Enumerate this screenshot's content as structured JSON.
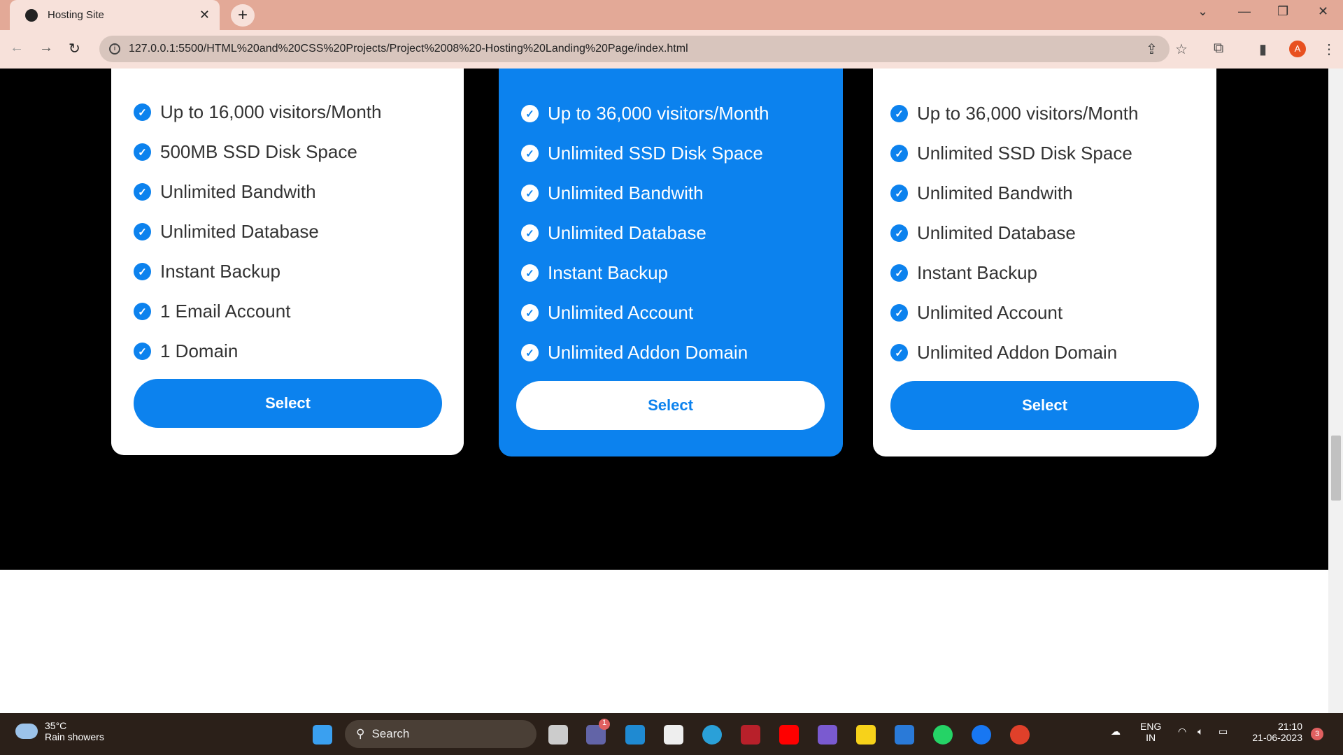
{
  "browser": {
    "tab_title": "Hosting Site",
    "url": "127.0.0.1:5500/HTML%20and%20CSS%20Projects/Project%2008%20-Hosting%20Landing%20Page/index.html",
    "profile_initial": "A"
  },
  "plans": [
    {
      "features": [
        "Up to 16,000 visitors/Month",
        "500MB SSD Disk Space",
        "Unlimited Bandwith",
        "Unlimited Database",
        "Instant Backup",
        "1 Email Account",
        "1 Domain"
      ],
      "button": "Select",
      "featured": false
    },
    {
      "features": [
        "Up to 36,000 visitors/Month",
        "Unlimited SSD Disk Space",
        "Unlimited Bandwith",
        "Unlimited Database",
        "Instant Backup",
        "Unlimited Account",
        "Unlimited Addon Domain"
      ],
      "button": "Select",
      "featured": true
    },
    {
      "features": [
        "Up to 36,000 visitors/Month",
        "Unlimited SSD Disk Space",
        "Unlimited Bandwith",
        "Unlimited Database",
        "Instant Backup",
        "Unlimited Account",
        "Unlimited Addon Domain"
      ],
      "button": "Select",
      "featured": false
    }
  ],
  "taskbar": {
    "temp": "35°C",
    "weather": "Rain showers",
    "search": "Search",
    "lang": "ENG",
    "region": "IN",
    "time": "21:10",
    "date": "21-06-2023",
    "notifications": "3",
    "teams_badge": "1"
  },
  "colors": {
    "accent": "#0c82ee"
  }
}
